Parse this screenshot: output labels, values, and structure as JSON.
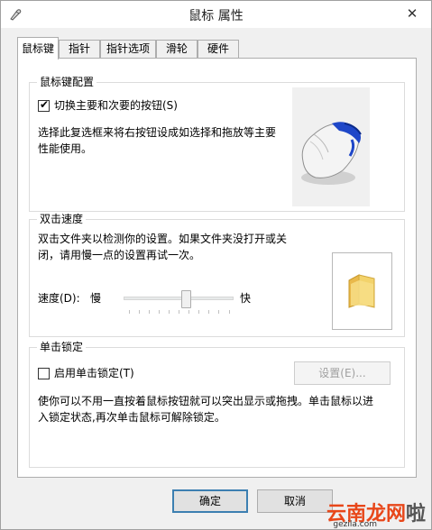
{
  "window": {
    "title": "鼠标 属性",
    "close_glyph": "✕"
  },
  "tabs": [
    {
      "label": "鼠标键",
      "active": true
    },
    {
      "label": "指针",
      "active": false
    },
    {
      "label": "指针选项",
      "active": false
    },
    {
      "label": "滑轮",
      "active": false
    },
    {
      "label": "硬件",
      "active": false
    }
  ],
  "button_config": {
    "group_title": "鼠标键配置",
    "swap_checkbox_label": "切换主要和次要的按钮(S)",
    "swap_checked": true,
    "description_line1": "选择此复选框来将右按钮设成如选择和拖放等主要",
    "description_line2": "性能使用。"
  },
  "double_click": {
    "group_title": "双击速度",
    "description_line1": "双击文件夹以检测你的设置。如果文件夹没打开或关",
    "description_line2": "闭，请用慢一点的设置再试一次。",
    "speed_label": "速度(D):",
    "slow_label": "慢",
    "fast_label": "快",
    "speed_fraction": 0.58,
    "test_icon": "folder-icon"
  },
  "click_lock": {
    "group_title": "单击锁定",
    "checkbox_label": "启用单击锁定(T)",
    "checked": false,
    "settings_button": "设置(E)...",
    "description_line1": "使你可以不用一直按着鼠标按钮就可以突出显示或拖拽。单击鼠标以进",
    "description_line2": "入锁定状态,再次单击鼠标可解除锁定。"
  },
  "footer": {
    "ok_label": "确定",
    "cancel_label": "取消"
  },
  "watermark": {
    "text": "云南龙网",
    "suffix": "啦",
    "url": "gezila.com"
  },
  "colors": {
    "mouse_accent": "#1f47c8",
    "folder": "#f3d36b"
  }
}
